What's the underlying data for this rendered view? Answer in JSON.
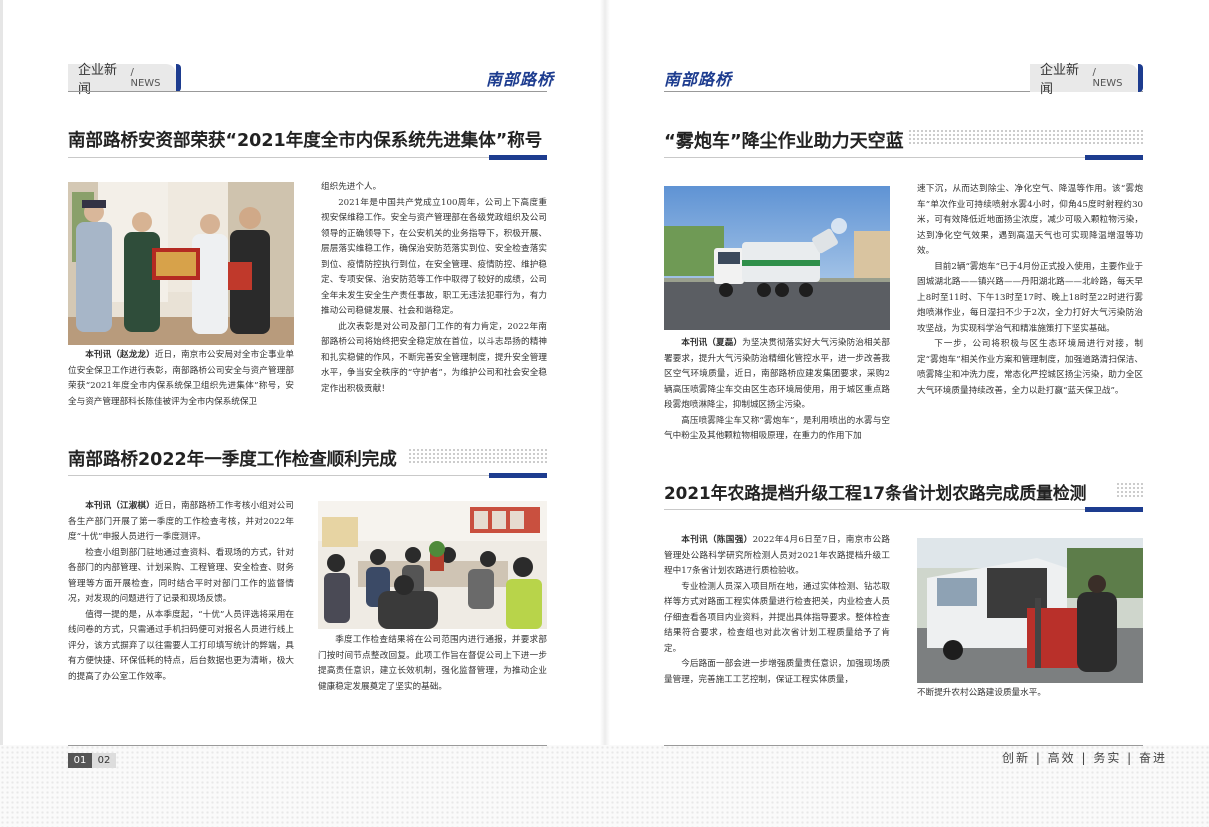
{
  "header": {
    "section_label": "企业新闻",
    "section_sub": "/ NEWS",
    "brand": "南部路桥"
  },
  "left": {
    "article1": {
      "title": "南部路桥安资部荣获“2021年度全市内保系统先进集体”称号",
      "caption_lead": "本刊讯（赵龙龙）",
      "caption_text": "近日，南京市公安局对全市企事业单位安全保卫工作进行表彰，南部路桥公司安全与资产管理部荣获“2021年度全市内保系统保卫组织先进集体”称号，安全与资产管理部科长陈佳被评为全市内保系统保卫",
      "col_p0": "组织先进个人。",
      "col_p1": "2021年是中国共产党成立100周年，公司上下高度重视安保维稳工作。安全与资产管理部在各级党政组织及公司领导的正确领导下，在公安机关的业务指导下，积极开展、层层落实维稳工作，确保治安防范落实到位、安全检查落实到位、疫情防控执行到位，在安全管理、疫情防控、维护稳定、专项安保、治安防范等工作中取得了较好的成绩，公司全年未发生安全生产责任事故，职工无违法犯罪行为，有力推动公司稳健发展、社会和谐稳定。",
      "col_p2": "此次表彰是对公司及部门工作的有力肯定，2022年南部路桥公司将始终把安全稳定放在首位，以斗志昂扬的精神和扎实稳健的作风，不断完善安全管理制度，提升安全管理水平，争当安全秩序的“守护者”，为维护公司和社会安全稳定作出积极贡献！"
    },
    "article2": {
      "title": "南部路桥2022年一季度工作检查顺利完成",
      "p1_lead": "本刊讯（江淑棋）",
      "p1": "近日，南部路桥工作考核小组对公司各生产部门开展了第一季度的工作检查考核，并对2022年度“十优”申报人员进行一季度测评。",
      "p2": "检查小组到部门驻地通过查资料、看现场的方式，针对各部门的内部管理、计划采购、工程管理、安全检查、财务管理等方面开展检查，同时结合平时对部门工作的监督情况，对发现的问题进行了记录和现场反馈。",
      "p3": "值得一提的是，从本季度起，“十优”人员评选将采用在线问卷的方式，只需通过手机扫码便可对报名人员进行线上评分，该方式摒弃了以往需要人工打印填写统计的弊端，具有方便快捷、环保低耗的特点，后台数据也更为清晰，极大的提高了办公室工作效率。",
      "col_text": "季度工作检查结果将在公司范围内进行通报，并要求部门按时间节点整改回复。此项工作旨在督促公司上下进一步提高责任意识，建立长效机制，强化监督管理，为推动企业健康稳定发展奠定了坚实的基础。"
    },
    "page_a": "01",
    "page_b": "02"
  },
  "right": {
    "article3": {
      "title": "“雾炮车”降尘作业助力天空蓝",
      "c1_lead": "本刊讯（夏磊）",
      "c1_p1": "为坚决贯彻落实好大气污染防治相关部署要求，提升大气污染防治精细化管控水平，进一步改善我区空气环境质量，近日，南部路桥应建发集团要求，采购2辆高压喷雾降尘车交由区生态环境局使用，用于城区重点路段雾炮喷淋降尘，抑制城区扬尘污染。",
      "c1_p2": "高压喷雾降尘车又称“雾炮车”，是利用喷出的水雾与空气中粉尘及其他颗粒物相吸原理，在重力的作用下加",
      "c2_p0": "速下沉，从而达到除尘、净化空气、降温等作用。该“雾炮车”单次作业可持续喷射水雾4小时，仰角45度时射程约30米，可有效降低近地面扬尘浓度，减少可吸入颗粒物污染，达到净化空气效果，遇到高温天气也可实现降温增湿等功效。",
      "c2_p1": "目前2辆“雾炮车”已于4月份正式投入使用，主要作业于固城湖北路——镇兴路——丹阳湖北路——北岭路，每天早上8时至11时、下午13时至17时、晚上18时至22时进行雾炮喷淋作业，每日湿扫不少于2次，全力打好大气污染防治攻坚战，为实现科学治气和精准施策打下坚实基础。",
      "c2_p2": "下一步，公司将积极与区生态环境局进行对接，制定“雾炮车”相关作业方案和管理制度，加强道路清扫保洁、喷雾降尘和冲洗力度，常态化严控城区扬尘污染，助力全区大气环境质量持续改善，全力以赴打赢“蓝天保卫战”。"
    },
    "article4": {
      "title": "2021年农路提档升级工程17条省计划农路完成质量检测",
      "p1_lead": "本刊讯（陈国强）",
      "p1": "2022年4月6日至7日，南京市公路管理处公路科学研究所检测人员对2021年农路提档升级工程中17条省计划农路进行质检验收。",
      "p2": "专业检测人员深入项目所在地，通过实体检测、钻芯取样等方式对路面工程实体质量进行检查把关，内业检查人员仔细查看各项目内业资料，并提出具体指导要求。整体检查结果符合要求，检查组也对此次省计划工程质量给予了肯定。",
      "p3": "今后路面一部会进一步增强质量责任意识，加强现场质量管理，完善施工工艺控制，保证工程实体质量，",
      "col_text": "不断提升农村公路建设质量水平。"
    },
    "slogan": "创新 | 高效 | 务实 | 奋进"
  }
}
